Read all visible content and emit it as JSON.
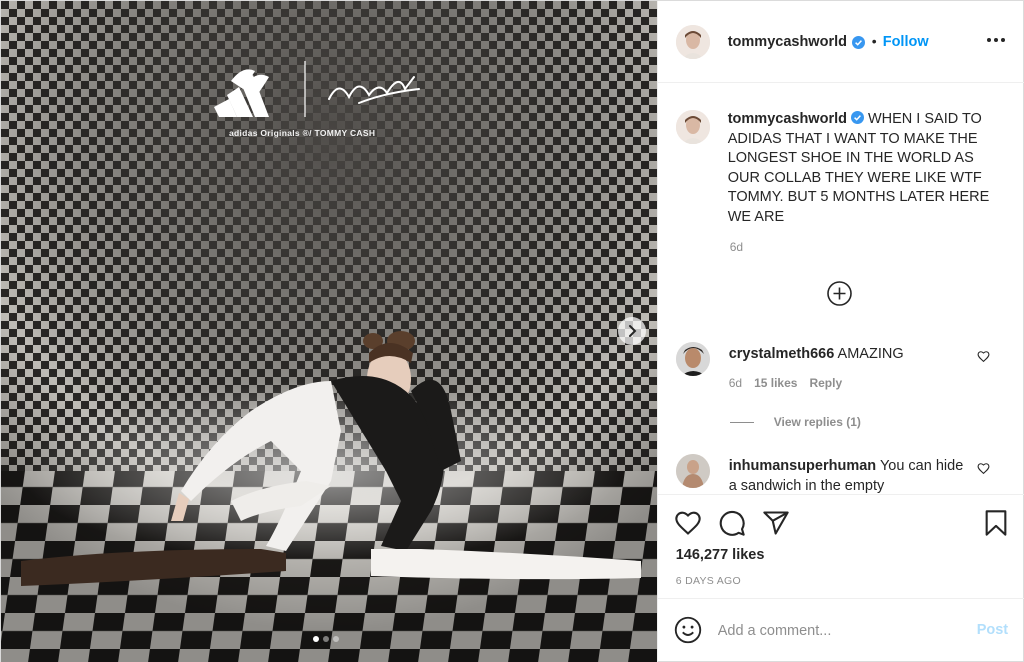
{
  "post": {
    "author": {
      "username": "tommycashworld",
      "verified": true,
      "follow_label": "Follow",
      "separator": "•"
    },
    "media": {
      "brand_caption": "adidas Originals ®/ TOMMY CASH",
      "carousel_count": 3,
      "carousel_active_index": 0
    },
    "caption": {
      "username": "tommycashworld",
      "text": "WHEN I SAID TO ADIDAS THAT I WANT TO MAKE THE LONGEST SHOE IN THE WORLD AS OUR COLLAB THEY WERE LIKE WTF TOMMY. BUT 5 MONTHS LATER HERE WE ARE",
      "time": "6d"
    },
    "comments": [
      {
        "username": "crystalmeth666",
        "text": "AMAZING",
        "time": "6d",
        "likes": "15 likes",
        "reply_label": "Reply",
        "view_replies": "View replies (1)"
      },
      {
        "username": "inhumansuperhuman",
        "text": "You can hide a sandwich in the empty"
      }
    ],
    "likes": "146,277 likes",
    "date": "6 DAYS AGO",
    "composer": {
      "placeholder": "Add a comment...",
      "post_label": "Post"
    },
    "icons": [
      "heart-icon",
      "comment-icon",
      "share-icon",
      "bookmark-icon",
      "emoji-icon",
      "plus-circle-icon",
      "more-icon",
      "verified-icon",
      "chevron-right-icon"
    ],
    "colors": {
      "accent": "#0095f6",
      "post_disabled": "#b2dffc",
      "secondary_text": "#8e8e8e",
      "primary_text": "#262626"
    }
  }
}
